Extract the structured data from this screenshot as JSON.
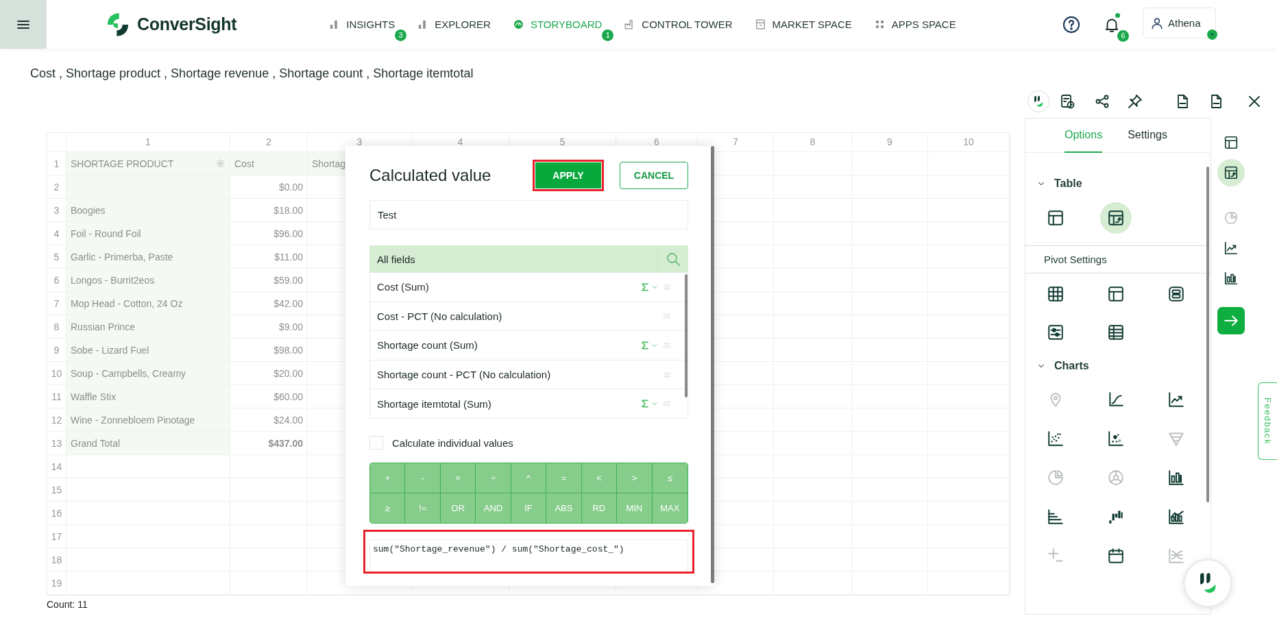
{
  "header": {
    "logo": "ConverSight",
    "nav": [
      {
        "label": "INSIGHTS",
        "kind": "bars",
        "selected": false,
        "badge": "3"
      },
      {
        "label": "EXPLORER",
        "kind": "bars",
        "selected": false
      },
      {
        "label": "STORYBOARD",
        "kind": "gauge",
        "selected": true,
        "badge": "1"
      },
      {
        "label": "CONTROL TOWER",
        "kind": "factory",
        "selected": false
      },
      {
        "label": "MARKET SPACE",
        "kind": "store",
        "selected": false
      },
      {
        "label": "APPS SPACE",
        "kind": "apps",
        "selected": false
      }
    ],
    "notifications": {
      "badge": "6",
      "unread": true
    },
    "user": {
      "name": "Athena"
    }
  },
  "subtitle": "Cost , Shortage product , Shortage revenue , Shortage count , Shortage itemtotal",
  "grid": {
    "column_numbers": [
      "1",
      "2",
      "3",
      "4",
      "5",
      "6",
      "7",
      "8",
      "9",
      "10"
    ],
    "row_numbers": [
      "1",
      "2",
      "3",
      "4",
      "5",
      "6",
      "7",
      "8",
      "9",
      "10",
      "11",
      "12",
      "13",
      "14",
      "15",
      "16",
      "17",
      "18",
      "19"
    ],
    "rows": [
      {
        "kind": "header",
        "label": "SHORTAGE PRODUCT",
        "value": "Cost",
        "column_3": "Shortag"
      },
      {
        "kind": "data",
        "value": "$0.00"
      },
      {
        "kind": "data",
        "label": "Boogies",
        "value": "$18.00"
      },
      {
        "kind": "data",
        "label": "Foil - Round Foil",
        "value": "$96.00"
      },
      {
        "kind": "data",
        "label": "Garlic - Primerba, Paste",
        "value": "$11.00"
      },
      {
        "kind": "data",
        "label": "Longos - Burrit2eos",
        "value": "$59.00"
      },
      {
        "kind": "data",
        "label": "Mop Head - Cotton, 24 Oz",
        "value": "$42.00"
      },
      {
        "kind": "data",
        "label": "Russian Prince",
        "value": "$9.00"
      },
      {
        "kind": "data",
        "label": "Sobe - Lizard Fuel",
        "value": "$98.00"
      },
      {
        "kind": "data",
        "label": "Soup - Campbells, Creamy",
        "value": "$20.00"
      },
      {
        "kind": "data",
        "label": "Waffle Stix",
        "value": "$60.00"
      },
      {
        "kind": "data",
        "label": "Wine - Zonnebloem Pinotage",
        "value": "$24.00"
      },
      {
        "kind": "total",
        "label": "Grand Total",
        "value": "$437.00"
      }
    ],
    "count": "Count: 11"
  },
  "dialog": {
    "title": "Calculated value",
    "apply_button": {
      "label": "APPLY",
      "highlighted": true
    },
    "cancel_button": "CANCEL",
    "name_field": {
      "value": "Test"
    },
    "fields": {
      "header": "All fields",
      "items": [
        {
          "label": "Cost (Sum)",
          "aggregate": true
        },
        {
          "label": "Cost - PCT (No calculation)",
          "aggregate": false
        },
        {
          "label": "Shortage count (Sum)",
          "aggregate": true
        },
        {
          "label": "Shortage count - PCT (No calculation)",
          "aggregate": false
        },
        {
          "label": "Shortage itemtotal (Sum)",
          "aggregate": true
        }
      ]
    },
    "checkbox": {
      "label": "Calculate individual values",
      "checked": false
    },
    "operators": [
      "+",
      "-",
      "×",
      "÷",
      "^",
      "=",
      "<",
      ">",
      "≤",
      "≥",
      "!=",
      "OR",
      "AND",
      "IF",
      "ABS",
      "RD",
      "MIN",
      "MAX"
    ],
    "formula": {
      "value": "sum(\"Shortage_revenue\") / sum(\"Shortage_cost_\")",
      "highlighted": true
    }
  },
  "panel": {
    "tabs": [
      {
        "label": "Options",
        "selected": true
      },
      {
        "label": "Settings",
        "selected": false
      }
    ],
    "table_section": {
      "label": "Table",
      "expanded": true,
      "items": [
        {
          "kind": "table",
          "selected": false
        },
        {
          "kind": "pivot",
          "selected": true
        }
      ]
    },
    "pivot_settings": {
      "label": "Pivot Settings",
      "items": [
        {
          "kind": "grid"
        },
        {
          "kind": "table"
        },
        {
          "kind": "cards"
        },
        {
          "kind": "sliders"
        },
        {
          "kind": "list"
        }
      ]
    },
    "charts_section": {
      "label": "Charts",
      "expanded": true,
      "items": [
        {
          "kind": "map",
          "disabled": true
        },
        {
          "kind": "curve",
          "disabled": false
        },
        {
          "kind": "trend",
          "disabled": false
        },
        {
          "kind": "scatter",
          "disabled": false
        },
        {
          "kind": "bubble",
          "disabled": false
        },
        {
          "kind": "funnel",
          "disabled": true
        },
        {
          "kind": "pie",
          "disabled": true
        },
        {
          "kind": "donut",
          "disabled": true
        },
        {
          "kind": "column",
          "disabled": false
        },
        {
          "kind": "hbar",
          "disabled": false
        },
        {
          "kind": "waterfall",
          "disabled": false
        },
        {
          "kind": "combo",
          "disabled": false
        },
        {
          "kind": "plusminus",
          "disabled": true
        },
        {
          "kind": "calendar",
          "disabled": false
        },
        {
          "kind": "sankey",
          "disabled": true
        }
      ]
    },
    "rail": [
      {
        "kind": "table",
        "selected": false,
        "disabled": false
      },
      {
        "kind": "pivot",
        "selected": true,
        "disabled": false
      },
      {
        "kind": "pie",
        "selected": false,
        "disabled": true
      },
      {
        "kind": "trend",
        "selected": false,
        "disabled": false
      },
      {
        "kind": "column",
        "selected": false,
        "disabled": false
      }
    ],
    "feedback": "Feedback"
  }
}
